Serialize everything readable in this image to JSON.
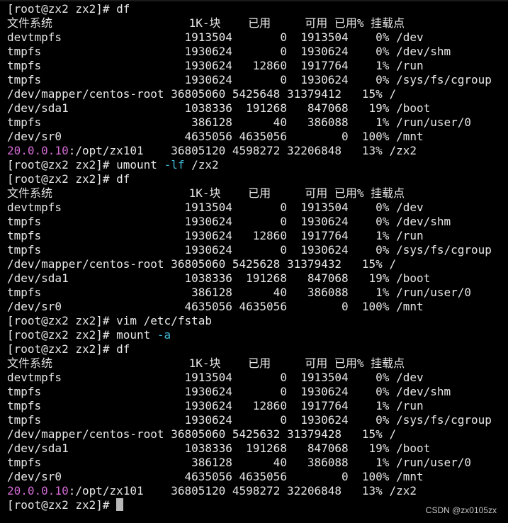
{
  "prompt_text": "[root@zx2 zx2]# ",
  "lines": [
    "[root@zx2 zx2]# df",
    "文件系统                    1K-块    已用     可用 已用% 挂载点",
    "devtmpfs                  1913504       0  1913504    0% /dev",
    "tmpfs                     1930624       0  1930624    0% /dev/shm",
    "tmpfs                     1930624   12860  1917764    1% /run",
    "tmpfs                     1930624       0  1930624    0% /sys/fs/cgroup",
    "/dev/mapper/centos-root 36805060 5425648 31379412   15% /",
    "/dev/sda1                 1038336  191268   847068   19% /boot",
    "tmpfs                      386128      40   386088    1% /run/user/0",
    "/dev/sr0                  4635056 4635056        0  100% /mnt"
  ],
  "nfs_row_1": {
    "ip": "20.0.0.10",
    "rest": ":/opt/zx101    36805120 4598272 32206848   13% /zx2"
  },
  "umount_cmd": {
    "prefix": "[root@zx2 zx2]# umount ",
    "option": "-lf",
    "suffix": " /zx2"
  },
  "lines2": [
    "[root@zx2 zx2]# df",
    "文件系统                    1K-块    已用     可用 已用% 挂载点",
    "devtmpfs                  1913504       0  1913504    0% /dev",
    "tmpfs                     1930624       0  1930624    0% /dev/shm",
    "tmpfs                     1930624   12860  1917764    1% /run",
    "tmpfs                     1930624       0  1930624    0% /sys/fs/cgroup",
    "/dev/mapper/centos-root 36805060 5425628 31379432   15% /",
    "/dev/sda1                 1038336  191268   847068   19% /boot",
    "tmpfs                      386128      40   386088    1% /run/user/0",
    "/dev/sr0                  4635056 4635056        0  100% /mnt",
    "[root@zx2 zx2]# vim /etc/fstab"
  ],
  "mount_cmd": {
    "prefix": "[root@zx2 zx2]# mount ",
    "option": "-a"
  },
  "lines3": [
    "[root@zx2 zx2]# df",
    "文件系统                    1K-块    已用     可用 已用% 挂载点",
    "devtmpfs                  1913504       0  1913504    0% /dev",
    "tmpfs                     1930624       0  1930624    0% /dev/shm",
    "tmpfs                     1930624   12860  1917764    1% /run",
    "tmpfs                     1930624       0  1930624    0% /sys/fs/cgroup",
    "/dev/mapper/centos-root 36805060 5425632 31379428   15% /",
    "/dev/sda1                 1038336  191268   847068   19% /boot",
    "tmpfs                      386128      40   386088    1% /run/user/0",
    "/dev/sr0                  4635056 4635056        0  100% /mnt"
  ],
  "nfs_row_2": {
    "ip": "20.0.0.10",
    "rest": ":/opt/zx101    36805120 4598272 32206848   13% /zx2"
  },
  "watermark": "CSDN @zx0105zx",
  "colors": {
    "background": "#000000",
    "text": "#e6e6e6",
    "ip_highlight": "#d36bd3",
    "option_highlight": "#3fb9d6",
    "cursor": "#b8b8b8"
  }
}
